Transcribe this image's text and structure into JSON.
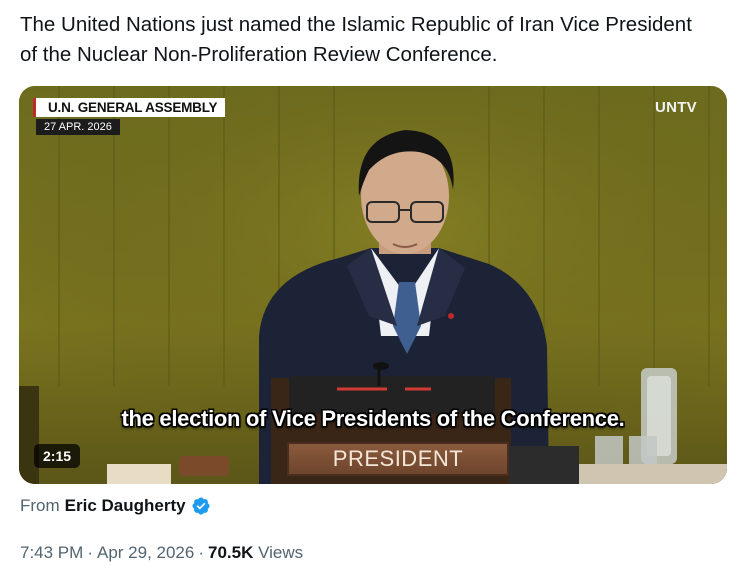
{
  "tweet": {
    "text": "The United Nations just named the Islamic Republic of Iran Vice President of the Nuclear Non-Proliferation Review Conference."
  },
  "video": {
    "badge_title": "U.N. GENERAL ASSEMBLY",
    "badge_date": "27 APR. 2026",
    "channel_logo": "UNTV",
    "caption": "the election of Vice Presidents of the Conference.",
    "nameplate": "PRESIDENT",
    "duration": "2:15"
  },
  "attribution": {
    "from_label": "From",
    "author_name": "Eric Daugherty",
    "verified_icon": "verified-badge-icon",
    "verified_color": "#1d9bf0"
  },
  "meta": {
    "time": "7:43 PM",
    "separator": "·",
    "date": "Apr 29, 2026",
    "views_count": "70.5K",
    "views_label": "Views"
  }
}
